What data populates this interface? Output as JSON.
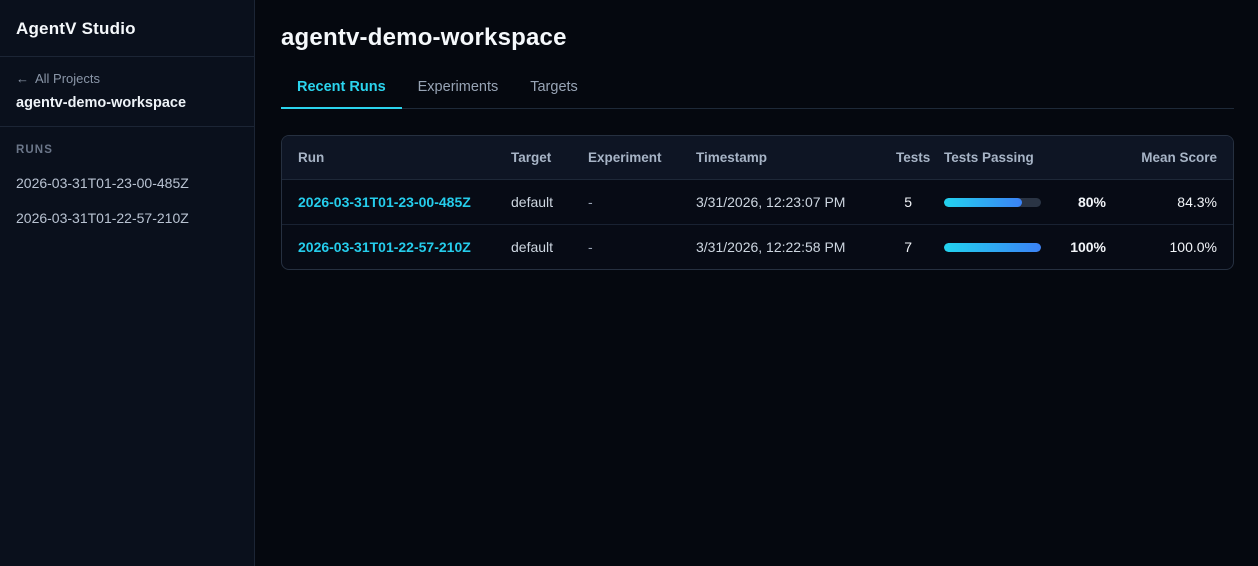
{
  "app": {
    "title": "AgentV Studio"
  },
  "sidebar": {
    "back_arrow": "←",
    "back_label": "All Projects",
    "workspace_name": "agentv-demo-workspace",
    "runs_section_label": "RUNS",
    "runs": [
      {
        "label": "2026-03-31T01-23-00-485Z"
      },
      {
        "label": "2026-03-31T01-22-57-210Z"
      }
    ]
  },
  "main": {
    "title": "agentv-demo-workspace",
    "tabs": [
      {
        "label": "Recent Runs",
        "active": true
      },
      {
        "label": "Experiments",
        "active": false
      },
      {
        "label": "Targets",
        "active": false
      }
    ],
    "table": {
      "columns": [
        "Run",
        "Target",
        "Experiment",
        "Timestamp",
        "Tests",
        "Tests Passing",
        "Mean Score"
      ],
      "rows": [
        {
          "run": "2026-03-31T01-23-00-485Z",
          "target": "default",
          "experiment": "-",
          "timestamp": "3/31/2026, 12:23:07 PM",
          "tests": "5",
          "tests_passing_pct": 80,
          "tests_passing_label": "80%",
          "mean_score": "84.3%"
        },
        {
          "run": "2026-03-31T01-22-57-210Z",
          "target": "default",
          "experiment": "-",
          "timestamp": "3/31/2026, 12:22:58 PM",
          "tests": "7",
          "tests_passing_pct": 100,
          "tests_passing_label": "100%",
          "mean_score": "100.0%"
        }
      ]
    }
  },
  "colors": {
    "accent_cyan": "#22d3ee",
    "accent_blue": "#3b82f6",
    "sidebar_bg": "#0a101c",
    "main_bg": "#05080f",
    "table_header_bg": "#0e1524",
    "border": "#263040"
  }
}
